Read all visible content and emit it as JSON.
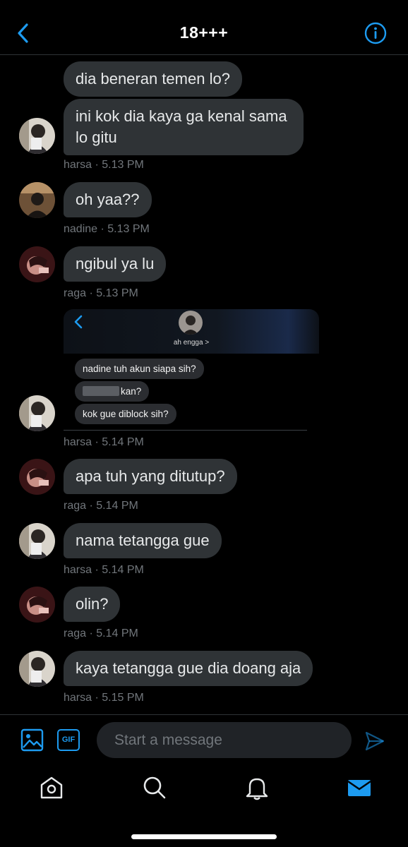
{
  "header": {
    "title": "18+++"
  },
  "messages": [
    {
      "sender": "harsa",
      "bubbles": [
        "dia beneran temen lo?",
        "ini kok dia kaya ga kenal sama lo gitu"
      ],
      "time": "harsa · 5.13 PM"
    },
    {
      "sender": "nadine",
      "bubbles": [
        "oh yaa??"
      ],
      "time": "nadine · 5.13 PM"
    },
    {
      "sender": "raga",
      "bubbles": [
        "ngibul ya lu"
      ],
      "time": "raga · 5.13 PM"
    },
    {
      "sender": "harsa",
      "screenshot": {
        "contact_name": "ah engga >",
        "lines": [
          "nadine tuh akun siapa sih?",
          "kan?",
          "kok gue diblock sih?"
        ]
      },
      "time": "harsa · 5.14 PM"
    },
    {
      "sender": "raga",
      "bubbles": [
        "apa tuh yang ditutup?"
      ],
      "time": "raga · 5.14 PM"
    },
    {
      "sender": "harsa",
      "bubbles": [
        "nama tetangga gue"
      ],
      "time": "harsa · 5.14 PM"
    },
    {
      "sender": "raga",
      "bubbles": [
        "olin?"
      ],
      "time": "raga · 5.14 PM"
    },
    {
      "sender": "harsa",
      "bubbles": [
        "kaya tetangga gue dia doang aja"
      ],
      "time": "harsa · 5.15 PM"
    }
  ],
  "composer": {
    "placeholder": "Start a message",
    "gif_label": "GIF"
  },
  "icons": {
    "back": "chevron-left-icon",
    "info": "info-circle-icon",
    "image": "image-icon",
    "send": "send-icon",
    "home": "home-icon",
    "search": "search-icon",
    "notifications": "bell-icon",
    "messages": "mail-icon"
  },
  "colors": {
    "accent": "#1d9bf0",
    "bubble": "#2f3336",
    "background": "#000000",
    "meta": "#71767b"
  }
}
